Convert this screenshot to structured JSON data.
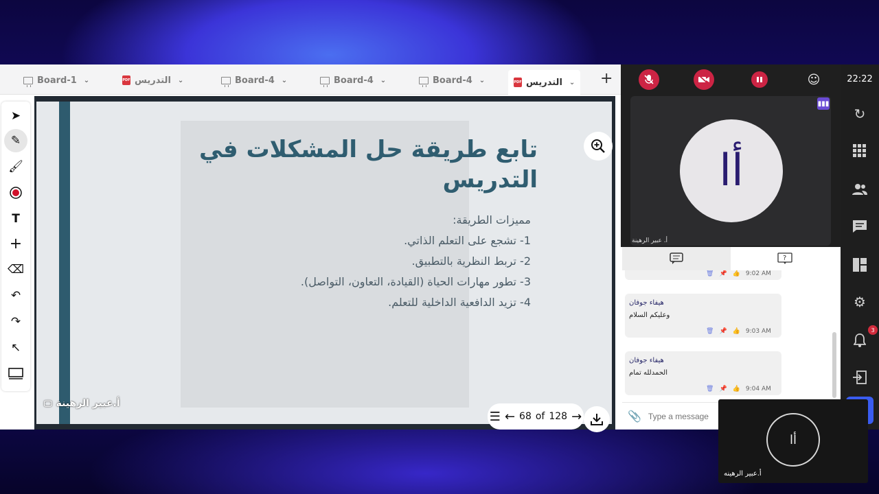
{
  "tabs": [
    {
      "label": "Board-1",
      "type": "board"
    },
    {
      "label": "التدريس",
      "type": "pdf"
    },
    {
      "label": "Board-4",
      "type": "board"
    },
    {
      "label": "Board-4",
      "type": "board"
    },
    {
      "label": "Board-4",
      "type": "board"
    },
    {
      "label": "التدريس",
      "type": "pdf",
      "active": true
    }
  ],
  "slide": {
    "title_line1": "تابع طريقة حل المشكلات في",
    "title_line2": "التدريس",
    "lines": [
      "مميزات الطريقة:",
      "1- تشجع على التعلم الذاتي.",
      "2- تربط النظرية بالتطبيق.",
      "3- تطور مهارات الحياة (القيادة، التعاون، التواصل).",
      "4- تزيد الدافعية الداخلية للتعلم."
    ]
  },
  "presenter_name": "أ.عبير الرهينة",
  "pager": {
    "current": "68",
    "of_label": "of",
    "total": "128"
  },
  "video": {
    "avatar_text": "أا",
    "tile_name": "أ. عبير الرهينة"
  },
  "chat": {
    "partial_time": "9:02 AM",
    "messages": [
      {
        "from": "هيفاء جوفان",
        "text": "وعليكم السلام",
        "time": "9:03 AM"
      },
      {
        "from": "هيفاء جوفان",
        "text": "الحمدلله تمام",
        "time": "9:04 AM"
      }
    ],
    "input_placeholder": "Type a message"
  },
  "rail": {
    "clock": "22:22",
    "notifications": "3"
  },
  "selfview": {
    "avatar_text": "أا",
    "name": "أ.عبير الرهينه"
  },
  "colors": {
    "accent": "#3a5cf0",
    "danger": "#cc2444",
    "slide_title": "#2f5d70"
  }
}
